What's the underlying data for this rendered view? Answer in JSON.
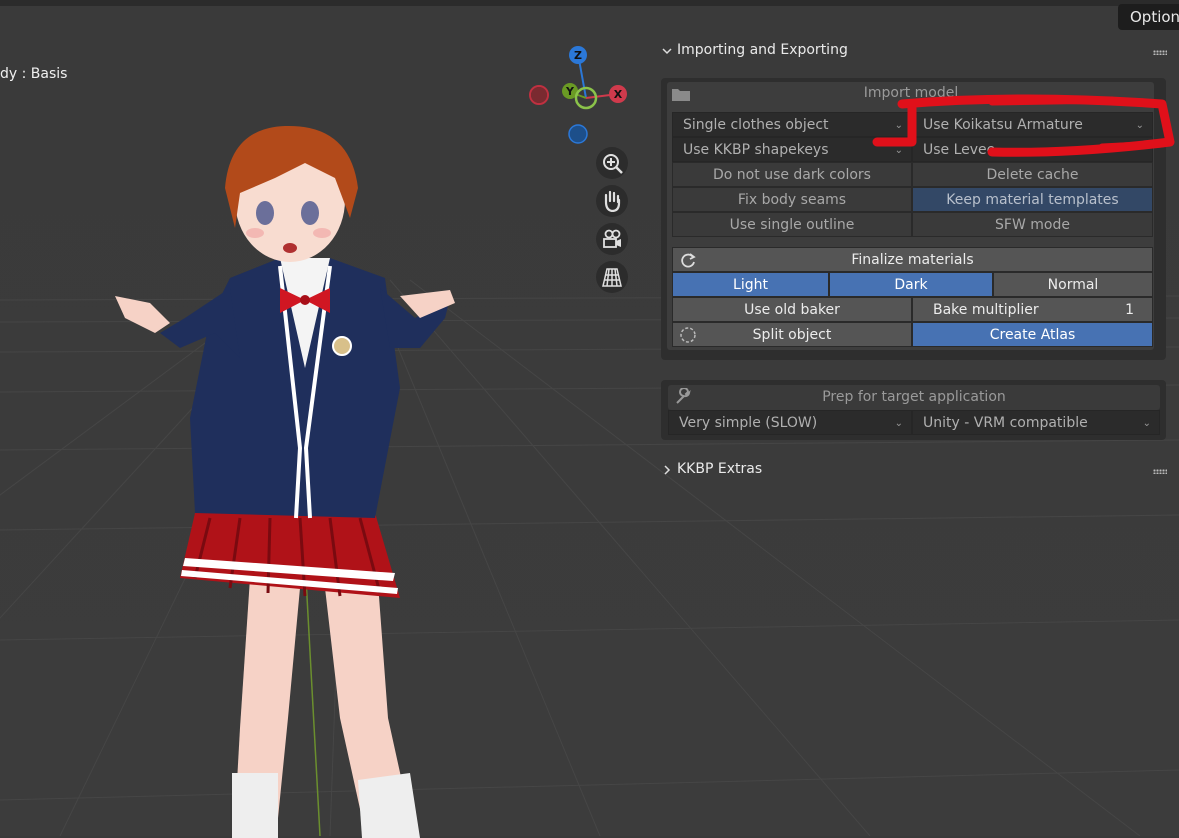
{
  "viewport": {
    "object_label": "dy : Basis",
    "options_label": "Options",
    "gizmo": {
      "z": "Z",
      "y": "Y",
      "x": "X"
    },
    "tools": [
      "zoom-icon",
      "hand-icon",
      "camera-icon",
      "grid-icon"
    ]
  },
  "panel": {
    "importing": {
      "title": "Importing and Exporting",
      "import_header": "Import model",
      "single_clothes": "Single clothes object",
      "armature": "Use Koikatsu Armature",
      "shapekeys": "Use KKBP shapekeys",
      "levee": "Use Levee",
      "dark_colors": "Do not use dark colors",
      "delete_cache": "Delete cache",
      "fix_seams": "Fix body seams",
      "keep_templates": "Keep material templates",
      "single_outline": "Use single outline",
      "sfw": "SFW mode",
      "finalize": "Finalize materials",
      "light": "Light",
      "dark": "Dark",
      "normal": "Normal",
      "old_baker": "Use old baker",
      "bake_multiplier_label": "Bake multiplier",
      "bake_multiplier_value": "1",
      "split": "Split object",
      "atlas": "Create Atlas",
      "prep_header": "Prep for target application",
      "simplify": "Very simple (SLOW)",
      "target": "Unity - VRM compatible"
    },
    "extras": {
      "title": "KKBP Extras"
    }
  },
  "colors": {
    "accent": "#4772b3",
    "annotation": "#e0101a"
  }
}
